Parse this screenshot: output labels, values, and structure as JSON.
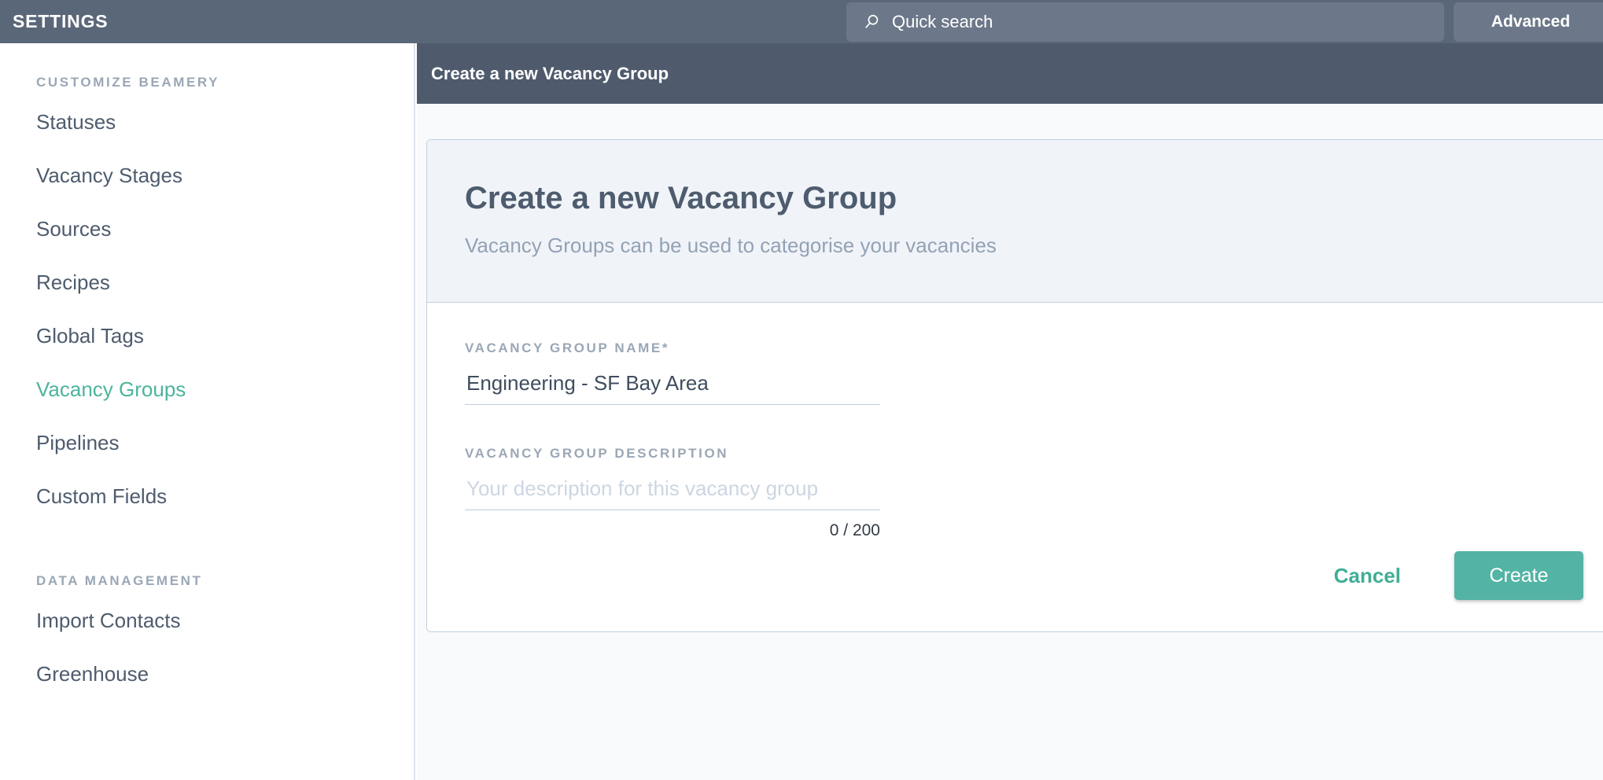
{
  "topbar": {
    "app_title": "SETTINGS",
    "search": {
      "placeholder": "Quick search",
      "value": "",
      "icon": "search-icon"
    },
    "advanced_label": "Advanced"
  },
  "sidebar": {
    "sections": [
      {
        "title": "CUSTOMIZE BEAMERY",
        "items": [
          {
            "label": "Statuses",
            "active": false
          },
          {
            "label": "Vacancy Stages",
            "active": false
          },
          {
            "label": "Sources",
            "active": false
          },
          {
            "label": "Recipes",
            "active": false
          },
          {
            "label": "Global Tags",
            "active": false
          },
          {
            "label": "Vacancy Groups",
            "active": true
          },
          {
            "label": "Pipelines",
            "active": false
          },
          {
            "label": "Custom Fields",
            "active": false
          }
        ]
      },
      {
        "title": "DATA MANAGEMENT",
        "items": [
          {
            "label": "Import Contacts",
            "active": false
          },
          {
            "label": "Greenhouse",
            "active": false
          }
        ]
      }
    ]
  },
  "content": {
    "header_title": "Create a new Vacancy Group",
    "card": {
      "title": "Create a new Vacancy Group",
      "subtitle": "Vacancy Groups can be used to categorise your vacancies",
      "fields": {
        "name": {
          "label": "VACANCY GROUP NAME",
          "required_marker": "*",
          "value": "Engineering - SF Bay Area",
          "placeholder": ""
        },
        "description": {
          "label": "VACANCY GROUP DESCRIPTION",
          "value": "",
          "placeholder": "Your description for this vacancy group",
          "counter": "0 / 200"
        }
      },
      "actions": {
        "cancel_label": "Cancel",
        "create_label": "Create"
      }
    }
  },
  "colors": {
    "topbar_bg": "#5a6779",
    "search_bg": "#6c7889",
    "content_header_bg": "#4f5b6d",
    "accent_teal": "#53b3a4",
    "active_link": "#4cb49c",
    "card_head_bg": "#f0f4f9",
    "content_bg": "#f8fafc"
  }
}
